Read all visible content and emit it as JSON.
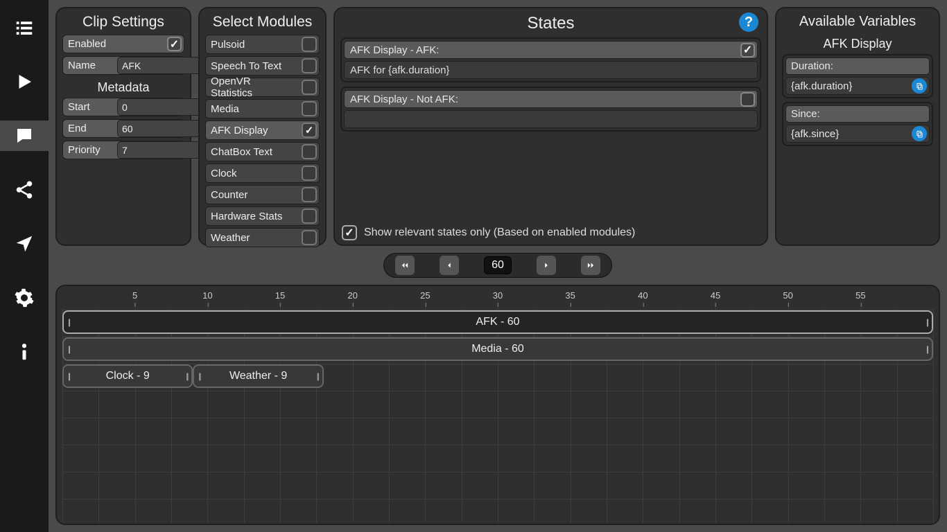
{
  "sidebar": {
    "items": [
      {
        "name": "list"
      },
      {
        "name": "play"
      },
      {
        "name": "chat",
        "active": true
      },
      {
        "name": "share"
      },
      {
        "name": "navigate"
      },
      {
        "name": "settings"
      },
      {
        "name": "info"
      }
    ]
  },
  "clip_settings": {
    "title": "Clip Settings",
    "enabled_label": "Enabled",
    "enabled": true,
    "name_label": "Name",
    "name_value": "AFK",
    "metadata_heading": "Metadata",
    "start_label": "Start",
    "start_value": "0",
    "end_label": "End",
    "end_value": "60",
    "priority_label": "Priority",
    "priority_value": "7"
  },
  "modules": {
    "title": "Select Modules",
    "items": [
      {
        "label": "Pulsoid",
        "checked": false
      },
      {
        "label": "Speech To Text",
        "checked": false
      },
      {
        "label": "OpenVR Statistics",
        "checked": false
      },
      {
        "label": "Media",
        "checked": false
      },
      {
        "label": "AFK Display",
        "checked": true
      },
      {
        "label": "ChatBox Text",
        "checked": false
      },
      {
        "label": "Clock",
        "checked": false
      },
      {
        "label": "Counter",
        "checked": false
      },
      {
        "label": "Hardware Stats",
        "checked": false
      },
      {
        "label": "Weather",
        "checked": false
      }
    ]
  },
  "states": {
    "title": "States",
    "help": "?",
    "items": [
      {
        "label": "AFK Display - AFK:",
        "checked": true,
        "body": "AFK for {afk.duration}"
      },
      {
        "label": "AFK Display - Not AFK:",
        "checked": false,
        "body": ""
      }
    ],
    "footer_checked": true,
    "footer_text": "Show relevant states only (Based on enabled modules)"
  },
  "variables": {
    "title": "Available Variables",
    "subtitle": "AFK Display",
    "items": [
      {
        "label": "Duration:",
        "value": "{afk.duration}"
      },
      {
        "label": "Since:",
        "value": "{afk.since}"
      }
    ]
  },
  "timeline_controls": {
    "value": "60"
  },
  "timeline": {
    "ticks": [
      "5",
      "10",
      "15",
      "20",
      "25",
      "30",
      "35",
      "40",
      "45",
      "50",
      "55"
    ],
    "total": 60,
    "clips": [
      {
        "label": "AFK - 60",
        "start": 0,
        "end": 60,
        "row": 0,
        "style": "bright"
      },
      {
        "label": "Media - 60",
        "start": 0,
        "end": 60,
        "row": 1,
        "style": "dim"
      },
      {
        "label": "Clock - 9",
        "start": 0,
        "end": 9,
        "row": 2,
        "style": "dim"
      },
      {
        "label": "Weather - 9",
        "start": 9,
        "end": 18,
        "row": 2,
        "style": "dim"
      }
    ]
  }
}
